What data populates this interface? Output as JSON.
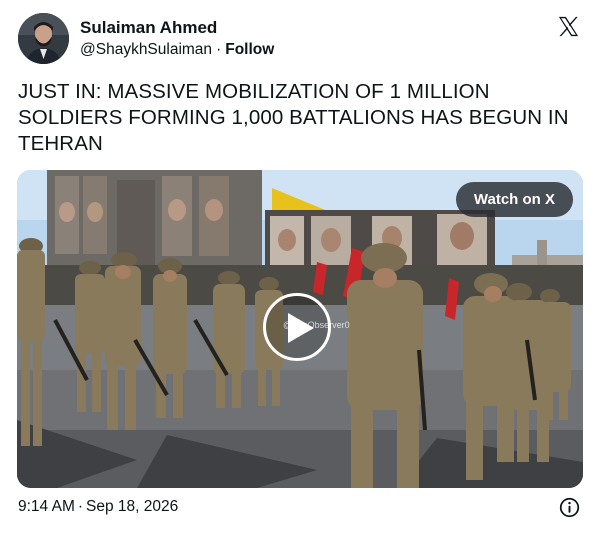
{
  "author": {
    "name": "Sulaiman Ahmed",
    "handle": "@ShaykhSulaiman",
    "separator": "·",
    "follow_label": "Follow"
  },
  "platform_icon": "x-logo-icon",
  "tweet": {
    "text": "JUST IN: MASSIVE MOBILIZATION OF 1 MILLION SOLDIERS FORMING 1,000 BATTALIONS HAS BEGUN IN TEHRAN"
  },
  "media": {
    "watch_label": "Watch on X",
    "watermark": "@IranObserver0",
    "play_icon": "play-icon"
  },
  "footer": {
    "time": "9:14 AM",
    "separator": "·",
    "date": "Sep 18, 2026",
    "info_icon": "info-icon"
  },
  "colors": {
    "text": "#0f1419",
    "uniform": "#8a7a5c",
    "flag_red": "#c8262a",
    "banner_yellow": "#e8c21c",
    "sky": "#b9d6ee"
  }
}
